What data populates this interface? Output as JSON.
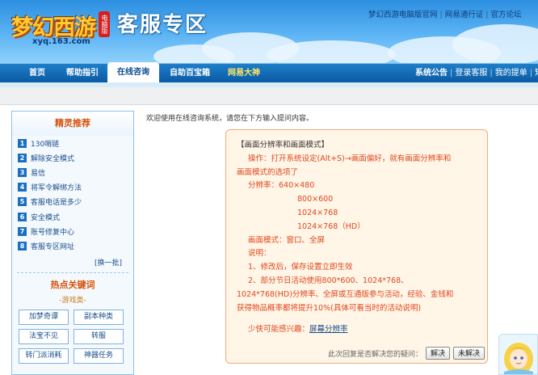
{
  "header": {
    "logo_text": "梦幻西游",
    "logo_badge": "电脑版",
    "logo_sub": "xyq.163.com",
    "title": "客服专区",
    "top_links": [
      "梦幻西游电脑版官网",
      "网易通行证",
      "官方论坛"
    ],
    "colors": {
      "sky": "#3b9be8",
      "nav": "#0b5aa2",
      "accent": "#e0451a"
    }
  },
  "nav": {
    "items": [
      {
        "label": "首页"
      },
      {
        "label": "帮助指引"
      },
      {
        "label": "在线咨询"
      },
      {
        "label": "自助百宝箱"
      },
      {
        "label": "网易大神"
      }
    ],
    "active": "在线咨询",
    "right": [
      "系统公告",
      "登录客服",
      "我的提单",
      "短"
    ]
  },
  "sidebar": {
    "title": "精灵推荐",
    "items": [
      {
        "num": "1",
        "label": "130哨链"
      },
      {
        "num": "2",
        "label": "解除安全模式"
      },
      {
        "num": "3",
        "label": "易信"
      },
      {
        "num": "4",
        "label": "将军令解绑方法"
      },
      {
        "num": "5",
        "label": "客服电话是多少"
      },
      {
        "num": "6",
        "label": "安全模式"
      },
      {
        "num": "7",
        "label": "账号修复中心"
      },
      {
        "num": "8",
        "label": "客服专区网址"
      }
    ],
    "swap": "[换一批]",
    "hot_title": "热点关键词",
    "category": "-游戏类-",
    "keywords": [
      "加梦奇谭",
      "副本种类",
      "法宝不见",
      "转服",
      "转门派消耗",
      "神器任务"
    ]
  },
  "main": {
    "welcome": "欢迎使用在线咨询系统，请您在下方输入提问内容。",
    "answer": {
      "heading": "【画面分辨率和画面模式】",
      "op_line1": "操作：打开系统设定(Alt+S)→画面偏好，就有画面分辨率和",
      "op_line2": "画面模式的选项了",
      "res_label": "分辨率：",
      "res": [
        "640×480",
        "800×600",
        "1024×768",
        "1024×768（HD）"
      ],
      "mode": "画面模式：窗口、全屏",
      "note": "说明：",
      "note1": "1、修改后，保存设置立即生效",
      "note2_line1": "2、部分节日活动使用800*600、1024*768、",
      "note2_line2": "1024*768(HD)分辨率、全屏或互通版参与活动，经验、金钱和",
      "note2_line3": "获得物品概率都将提升10%(具体可看当时的活动说明)",
      "interest_label": "少侠可能感兴趣：",
      "interest_link": "屏幕分辨率"
    },
    "feedback": {
      "question": "此次回复是否解决您的疑问：",
      "yes": "解决",
      "no": "未解决"
    }
  }
}
